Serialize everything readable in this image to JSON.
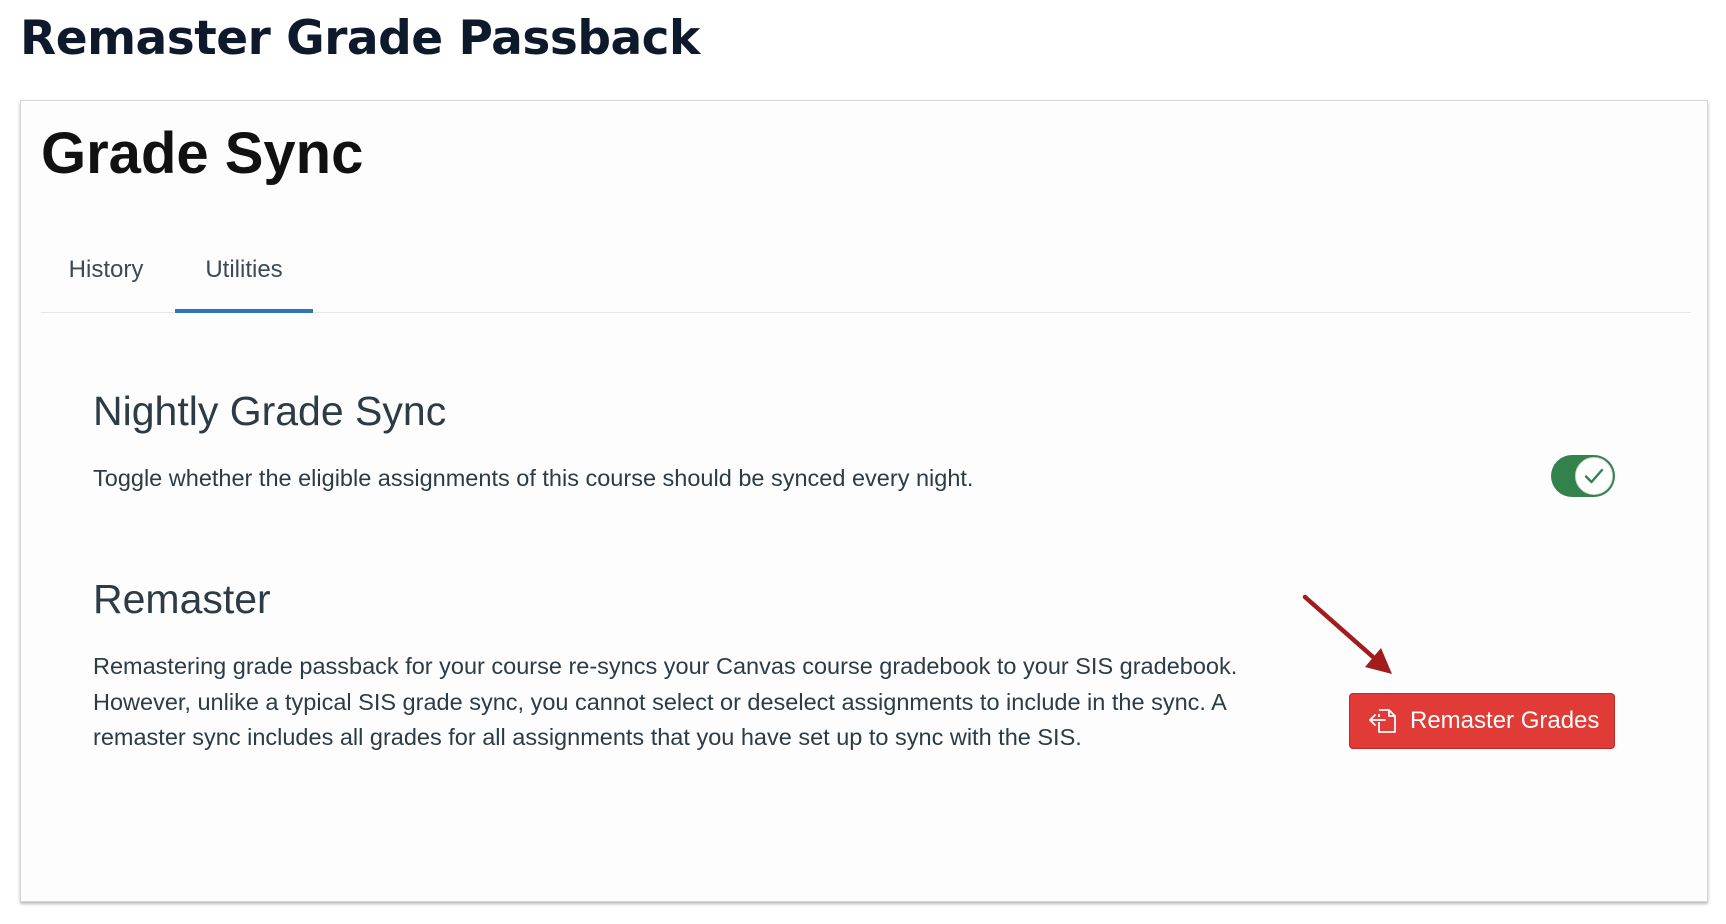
{
  "page": {
    "heading": "Remaster Grade Passback"
  },
  "app": {
    "title": "Grade Sync"
  },
  "tabs": [
    {
      "label": "History",
      "selected": false
    },
    {
      "label": "Utilities",
      "selected": true
    }
  ],
  "nightly_sync": {
    "heading": "Nightly Grade Sync",
    "description": "Toggle whether the eligible assignments of this course should be synced every night.",
    "toggle_on": true,
    "toggle_color": "#33824b",
    "toggle_icon": "checkmark-icon"
  },
  "remaster": {
    "heading": "Remaster",
    "description": "Remastering grade passback for your course re-syncs your Canvas course gradebook to your SIS gradebook. However, unlike a typical SIS grade sync, you cannot select or deselect assignments to include in the sync. A remaster sync includes all grades for all assignments that you have set up to sync with the SIS.",
    "button_label": "Remaster Grades",
    "button_color": "#e03b36",
    "button_icon": "import-icon",
    "annotation": "red-arrow-icon"
  },
  "colors": {
    "tab_indicator": "#2f75b8",
    "annotation_arrow": "#a31c1c"
  }
}
